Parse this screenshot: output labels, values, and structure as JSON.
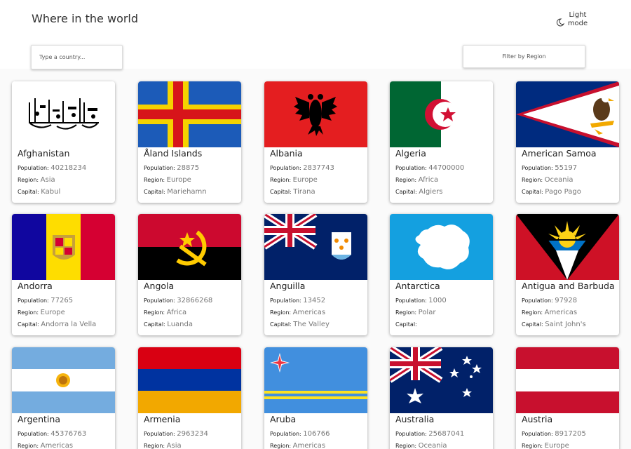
{
  "header": {
    "title": "Where in the world",
    "mode_label": "Light mode"
  },
  "search": {
    "placeholder": "Type a country..."
  },
  "filter": {
    "label": "Filter by Region"
  },
  "labels": {
    "population": "Population:",
    "region": "Region:",
    "capital": "Capital:"
  },
  "countries": [
    {
      "name": "Afghanistan",
      "population": "40218234",
      "region": "Asia",
      "capital": "Kabul"
    },
    {
      "name": "Åland Islands",
      "population": "28875",
      "region": "Europe",
      "capital": "Mariehamn"
    },
    {
      "name": "Albania",
      "population": "2837743",
      "region": "Europe",
      "capital": "Tirana"
    },
    {
      "name": "Algeria",
      "population": "44700000",
      "region": "Africa",
      "capital": "Algiers"
    },
    {
      "name": "American Samoa",
      "population": "55197",
      "region": "Oceania",
      "capital": "Pago Pago"
    },
    {
      "name": "Andorra",
      "population": "77265",
      "region": "Europe",
      "capital": "Andorra la Vella"
    },
    {
      "name": "Angola",
      "population": "32866268",
      "region": "Africa",
      "capital": "Luanda"
    },
    {
      "name": "Anguilla",
      "population": "13452",
      "region": "Americas",
      "capital": "The Valley"
    },
    {
      "name": "Antarctica",
      "population": "1000",
      "region": "Polar",
      "capital": ""
    },
    {
      "name": "Antigua and Barbuda",
      "population": "97928",
      "region": "Americas",
      "capital": "Saint John's"
    },
    {
      "name": "Argentina",
      "population": "45376763",
      "region": "Americas",
      "capital": ""
    },
    {
      "name": "Armenia",
      "population": "2963234",
      "region": "Asia",
      "capital": ""
    },
    {
      "name": "Aruba",
      "population": "106766",
      "region": "Americas",
      "capital": ""
    },
    {
      "name": "Australia",
      "population": "25687041",
      "region": "Oceania",
      "capital": ""
    },
    {
      "name": "Austria",
      "population": "8917205",
      "region": "Europe",
      "capital": ""
    }
  ]
}
